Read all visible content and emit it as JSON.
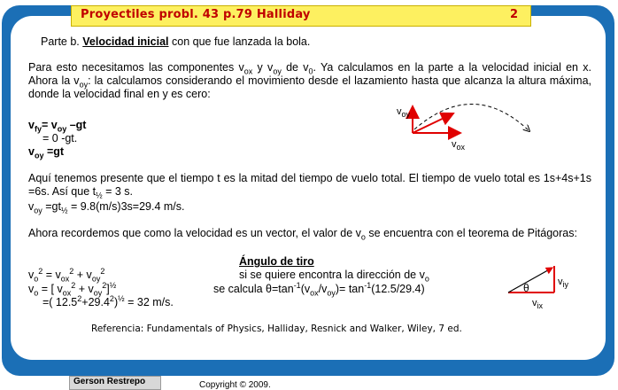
{
  "title": {
    "text": "Proyectiles   probl. 43  p.79 Halliday",
    "page": "2"
  },
  "part": {
    "prefix": "Parte b. ",
    "heading": "Velocidad inicial",
    "suffix": " con que fue lanzada la bola."
  },
  "intro": {
    "a1": "Para esto necesitamos las componentes v",
    "s1": "ox",
    "a2": " y v",
    "s2": "oy",
    "a3": " de v",
    "s3": "0",
    "a4": ". Ya calculamos en la parte a la velocidad inicial en x. Ahora la v",
    "s4": "oy",
    "a5": ": la calculamos considerando el movimiento desde el lazamiento hasta que alcanza la altura máxima, donde la velocidad final en y es cero:"
  },
  "eq1": {
    "l1_v": "v",
    "l1_sub": "fy",
    "l1_rest": "= v",
    "l1_sub2": "oy",
    "l1_end": " –gt",
    "l2": "= 0     -gt.",
    "l3_v": "v",
    "l3_sub": "oy",
    "l3_end": " =gt"
  },
  "time_par": {
    "p1": "Aquí tenemos presente que el tiempo t es la mitad del tiempo de vuelo total. El tiempo de vuelo total es 1s+4s+1s  =6s. Así que t",
    "p1_sub": "½",
    "p1_end": " = 3 s.",
    "p2_v": "v",
    "p2_sub": "oy",
    "p2_mid": " =gt",
    "p2_sub2": "½",
    "p2_end": "   = 9.8(m/s)3s=29.4 m/s."
  },
  "pyth": {
    "p1": "Ahora recordemos que como la velocidad es un vector, el valor de v",
    "p1_sub": "o",
    "p1_end": " se encuentra con el teorema de Pitágoras:"
  },
  "formulas": {
    "f1_a": "v",
    "f1_s1": "o",
    "f1_sp1": "2",
    "f1_b": " = v",
    "f1_s2": "ox",
    "f1_sp2": "2",
    "f1_c": " + v",
    "f1_s3": "oy",
    "f1_sp3": "2",
    "f2_a": "v",
    "f2_s1": "o",
    "f2_b": " = [ v",
    "f2_s2": "ox",
    "f2_sp2": "2",
    "f2_c": " + v",
    "f2_s3": "oy",
    "f2_sp3": "2",
    "f2_d": "]",
    "f2_sp4": "½",
    "f3_a": "=( 12.5",
    "f3_sp1": "2",
    "f3_b": "+29.4",
    "f3_sp2": "2",
    "f3_c": ")",
    "f3_sp3": "½",
    "f3_d": "  = 32 m/s."
  },
  "angle": {
    "heading": "Ángulo de tiro",
    "l1_a": "si se quiere encontra la dirección de v",
    "l1_sub": "o",
    "l2_a": "se calcula θ=tan",
    "l2_sup1": "-1",
    "l2_b": "(v",
    "l2_s1": "ox",
    "l2_c": "/v",
    "l2_s2": "oy",
    "l2_d": ")= tan",
    "l2_sup2": "-1",
    "l2_e": "(12.5/29.4)"
  },
  "diagram1": {
    "vy_label": "v",
    "vy_sub": "oy",
    "vx_label": "v",
    "vx_sub": "ox"
  },
  "diagram2": {
    "theta": "θ",
    "vy_label": "v",
    "vy_sub": "iy",
    "vx_label": "v",
    "vx_sub": "ix"
  },
  "reference": "Referencia: Fundamentals of Physics, Halliday,  Resnick and Walker, Wiley, 7 ed.",
  "footer": {
    "author": "Gerson Restrepo",
    "copyright": "Copyright © 2009."
  },
  "colors": {
    "frame": "#1b6fb6",
    "title_bg": "#fdf060",
    "title_text": "#c00000",
    "arrow": "#e00000"
  }
}
